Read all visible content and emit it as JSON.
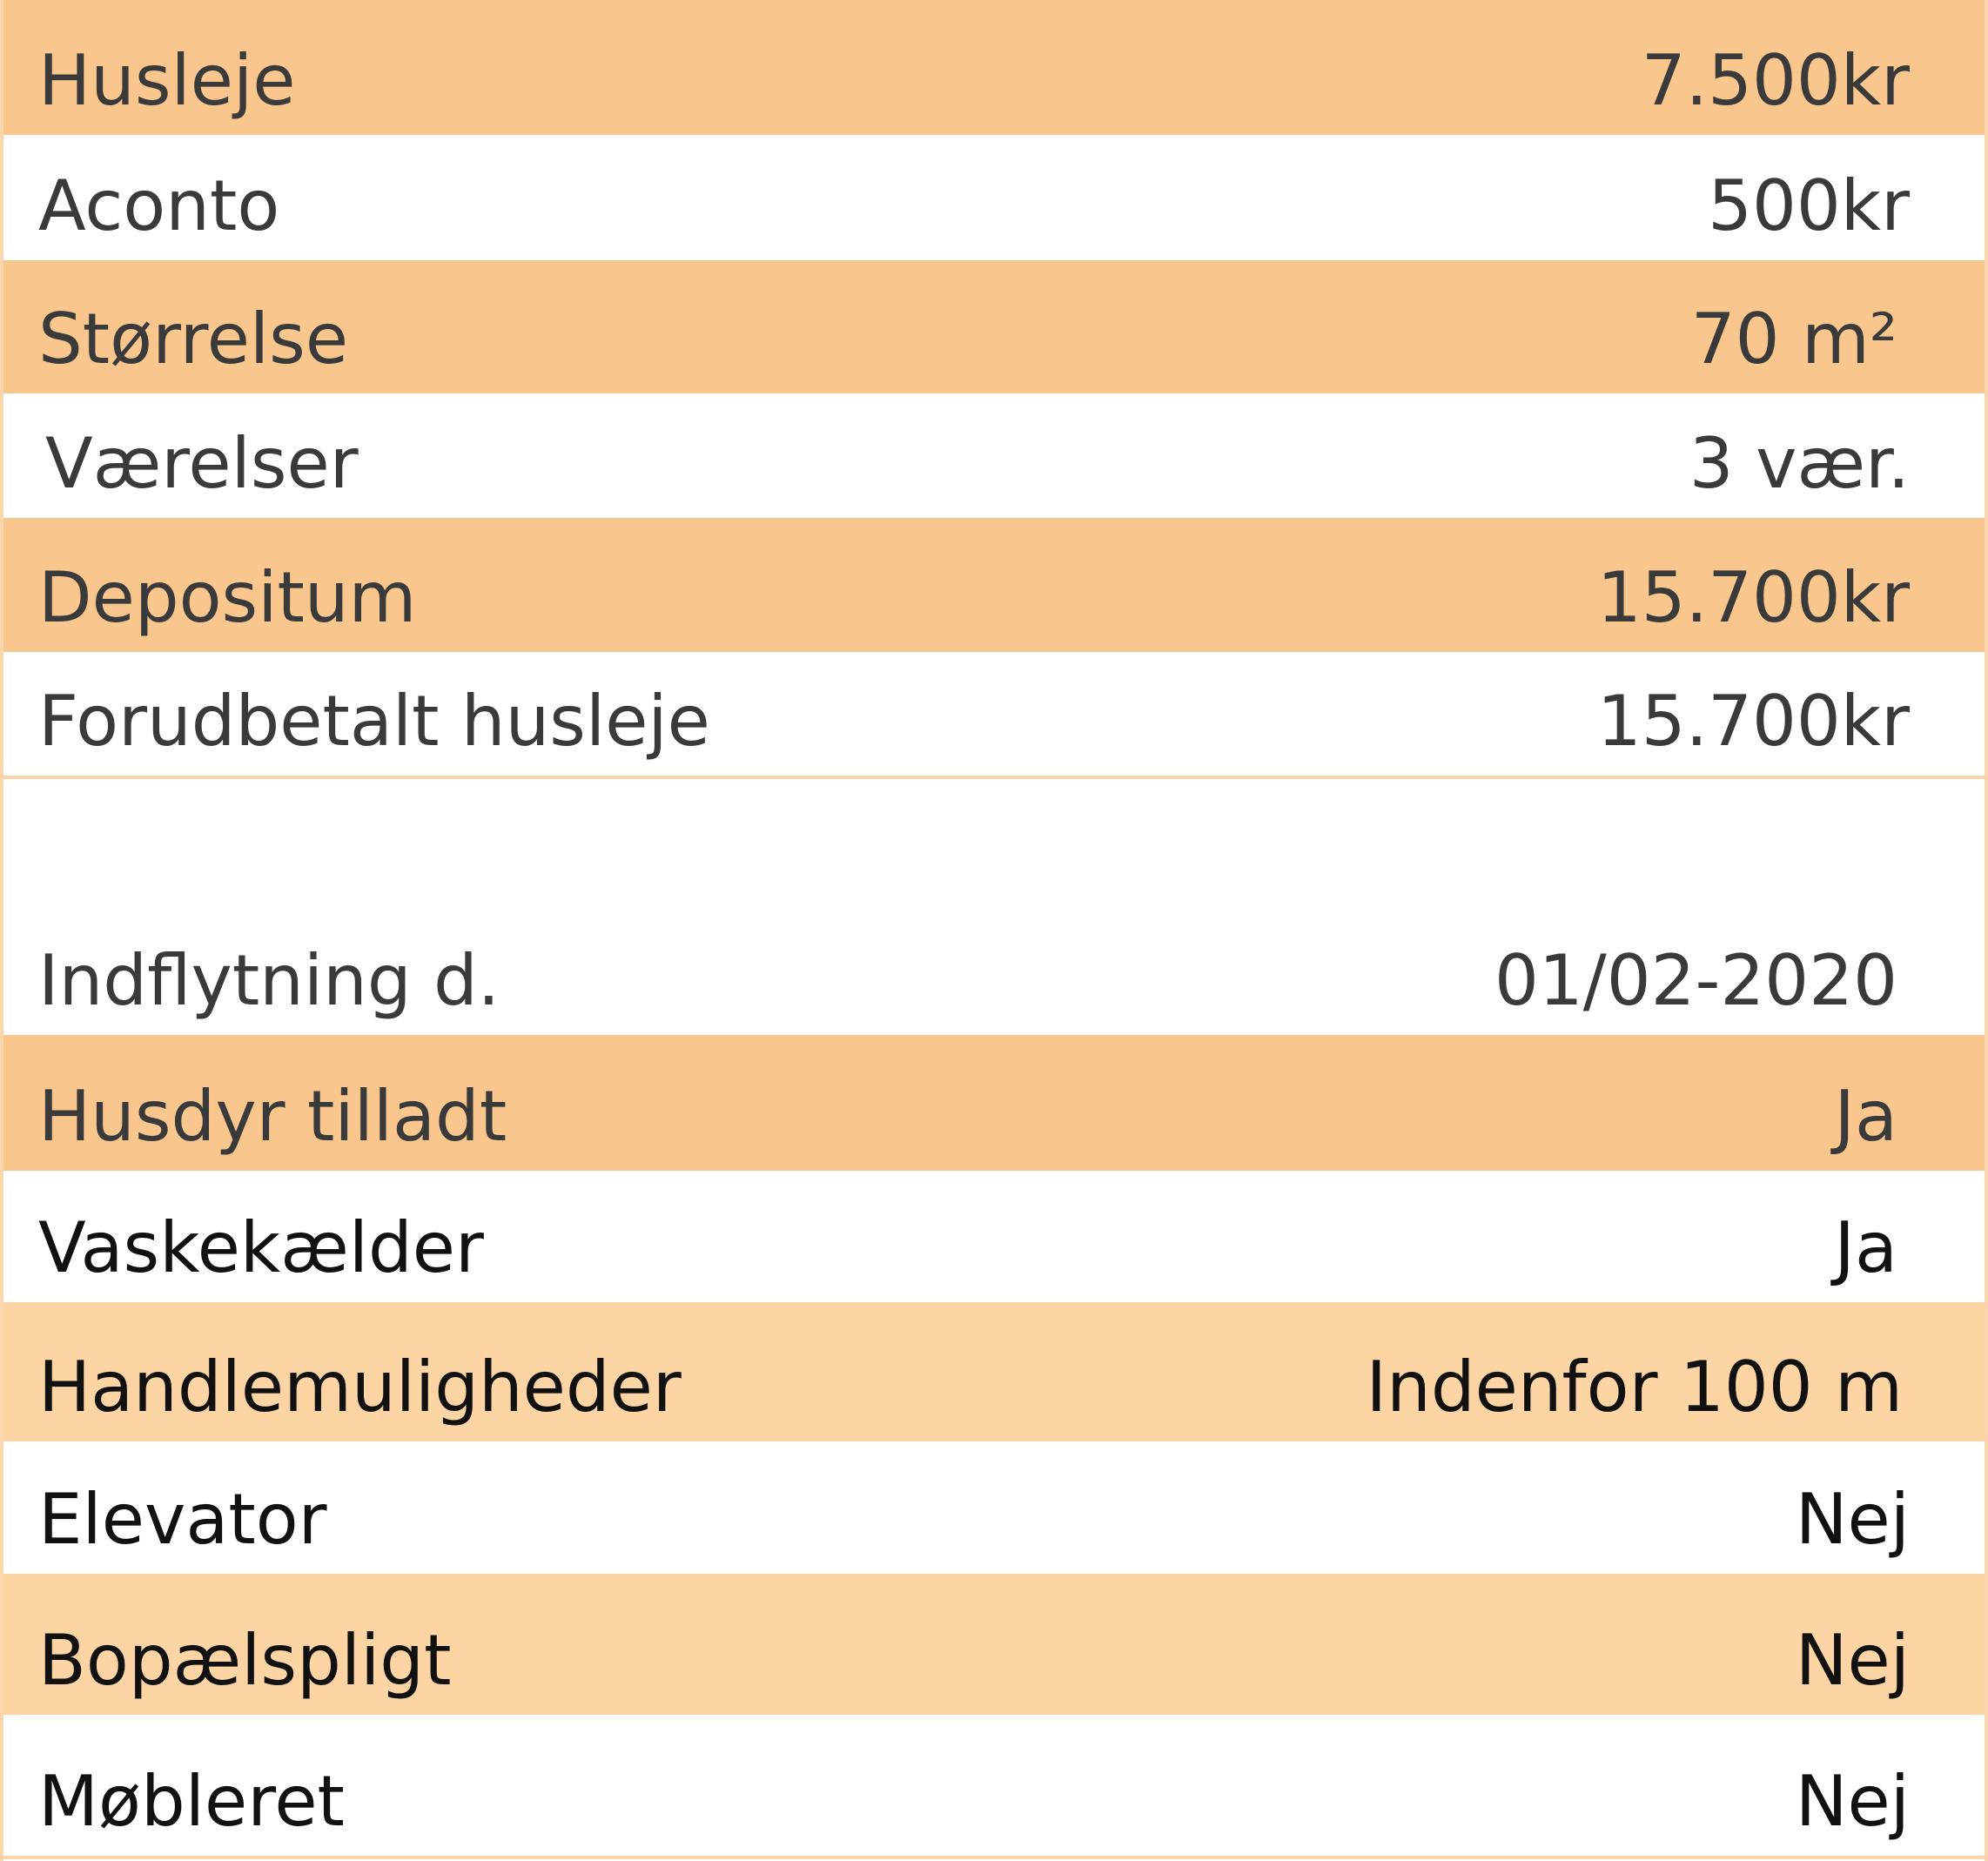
{
  "colors": {
    "stripe_strong": "#f9c68e",
    "stripe_light": "#fdd5a5",
    "text_grey": "#3a3a3a",
    "text_black": "#111111"
  },
  "rows": [
    {
      "label": "Husleje",
      "value": "7.500kr"
    },
    {
      "label": "Aconto",
      "value": "500kr"
    },
    {
      "label": "Størrelse",
      "value": "70 m²"
    },
    {
      "label": "Værelser",
      "value": "3 vær."
    },
    {
      "label": "Depositum",
      "value": "15.700kr"
    },
    {
      "label": "Forudbetalt husleje",
      "value": "15.700kr"
    },
    {
      "label": "Indflytning d.",
      "value": "01/02-2020"
    },
    {
      "label": "Husdyr tilladt",
      "value": "Ja"
    },
    {
      "label": "Vaskekælder",
      "value": "Ja"
    },
    {
      "label": "Handlemuligheder",
      "value": "Indenfor 100 m"
    },
    {
      "label": "Elevator",
      "value": "Nej"
    },
    {
      "label": "Bopælspligt",
      "value": "Nej"
    },
    {
      "label": "Møbleret",
      "value": "Nej"
    }
  ]
}
